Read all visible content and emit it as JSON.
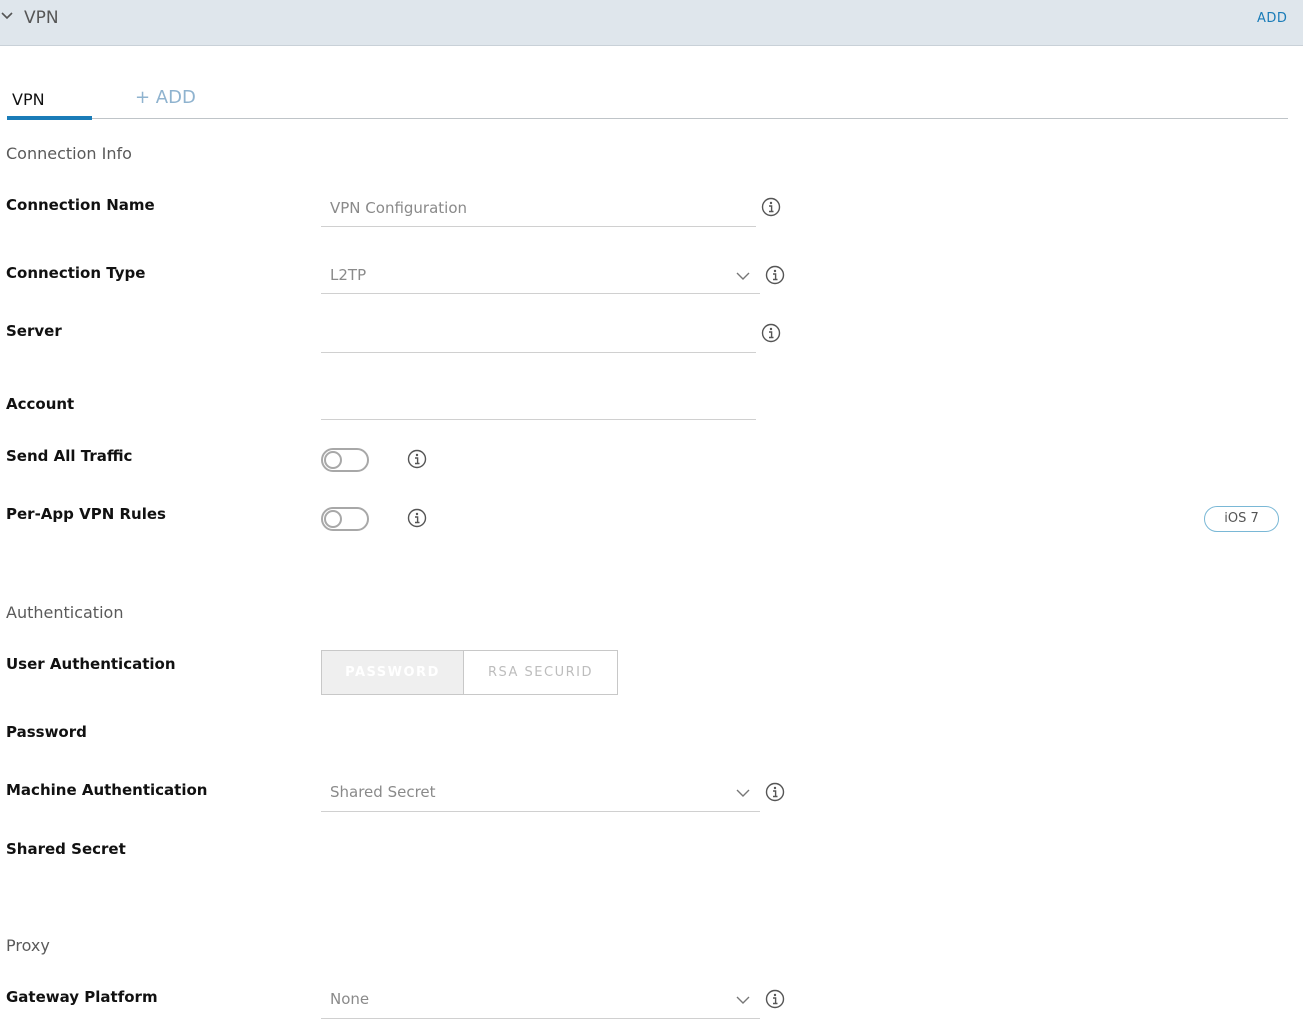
{
  "header": {
    "title": "VPN",
    "add_label": "ADD"
  },
  "tabs": {
    "active_label": "VPN",
    "add_label": "+ ADD"
  },
  "sections": {
    "connection_info": "Connection Info",
    "authentication": "Authentication",
    "proxy": "Proxy"
  },
  "fields": {
    "connection_name": {
      "label": "Connection Name",
      "placeholder": "VPN Configuration"
    },
    "connection_type": {
      "label": "Connection Type",
      "value": "L2TP"
    },
    "server": {
      "label": "Server",
      "value": ""
    },
    "account": {
      "label": "Account",
      "value": ""
    },
    "send_all_traffic": {
      "label": "Send All Traffic",
      "enabled": false
    },
    "per_app_vpn_rules": {
      "label": "Per-App VPN Rules",
      "enabled": false,
      "badge": "iOS 7"
    },
    "user_authentication": {
      "label": "User Authentication",
      "options": [
        "PASSWORD",
        "RSA SECURID"
      ],
      "selected": "PASSWORD"
    },
    "password": {
      "label": "Password"
    },
    "machine_authentication": {
      "label": "Machine Authentication",
      "value": "Shared Secret"
    },
    "shared_secret": {
      "label": "Shared Secret"
    },
    "gateway_platform": {
      "label": "Gateway Platform",
      "value": "None"
    }
  },
  "icons": {
    "header_chevron": "chevron-down-icon",
    "info": "info-icon",
    "dropdown": "chevron-down-icon"
  },
  "colors": {
    "accent": "#1a7cb8",
    "header_bg": "#dfe6ec"
  }
}
